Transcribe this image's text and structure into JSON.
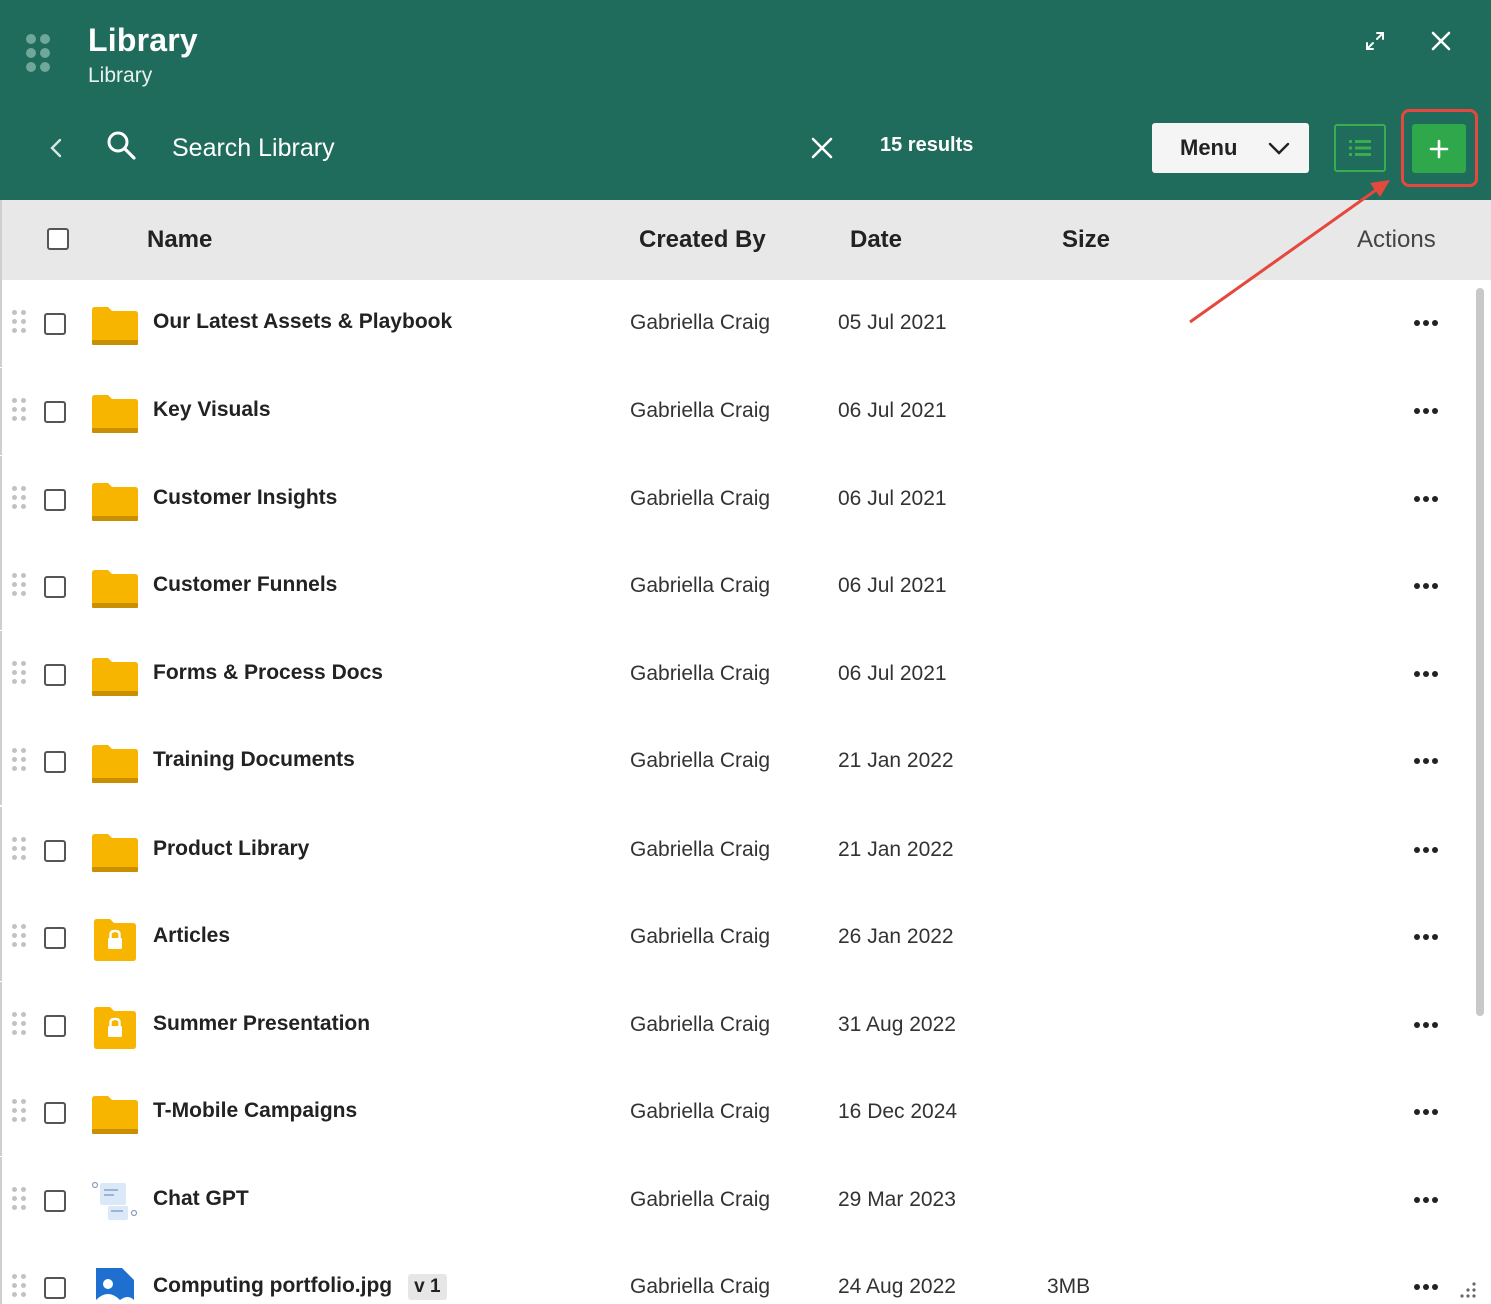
{
  "window": {
    "title": "Library",
    "subtitle": "Library"
  },
  "toolbar": {
    "search_placeholder": "Search Library",
    "results": "15 results",
    "menu_label": "Menu"
  },
  "columns": {
    "name": "Name",
    "created_by": "Created By",
    "date": "Date",
    "size": "Size",
    "actions": "Actions"
  },
  "colors": {
    "header_bg": "#1f6b5c",
    "add_button": "#2ea84a",
    "folder": "#f7b500",
    "highlight": "#e5483c"
  },
  "rows": [
    {
      "name": "Our Latest Assets & Playbook",
      "created_by": "Gabriella Craig",
      "date": "05 Jul 2021",
      "size": "",
      "icon": "folder-icon"
    },
    {
      "name": "Key Visuals",
      "created_by": "Gabriella Craig",
      "date": "06 Jul 2021",
      "size": "",
      "icon": "folder-icon"
    },
    {
      "name": "Customer Insights",
      "created_by": "Gabriella Craig",
      "date": "06 Jul 2021",
      "size": "",
      "icon": "folder-icon"
    },
    {
      "name": "Customer Funnels",
      "created_by": "Gabriella Craig",
      "date": "06 Jul 2021",
      "size": "",
      "icon": "folder-icon"
    },
    {
      "name": "Forms & Process Docs",
      "created_by": "Gabriella Craig",
      "date": "06 Jul 2021",
      "size": "",
      "icon": "folder-icon"
    },
    {
      "name": "Training Documents",
      "created_by": "Gabriella Craig",
      "date": "21 Jan 2022",
      "size": "",
      "icon": "folder-icon"
    },
    {
      "name": "Product Library",
      "created_by": "Gabriella Craig",
      "date": "21 Jan 2022",
      "size": "",
      "icon": "folder-icon"
    },
    {
      "name": "Articles",
      "created_by": "Gabriella Craig",
      "date": "26 Jan 2022",
      "size": "",
      "icon": "locked-folder-icon"
    },
    {
      "name": "Summer Presentation",
      "created_by": "Gabriella Craig",
      "date": "31 Aug 2022",
      "size": "",
      "icon": "locked-folder-icon"
    },
    {
      "name": "T-Mobile Campaigns",
      "created_by": "Gabriella Craig",
      "date": "16 Dec 2024",
      "size": "",
      "icon": "folder-icon"
    },
    {
      "name": "Chat GPT",
      "created_by": "Gabriella Craig",
      "date": "29 Mar 2023",
      "size": "",
      "icon": "document-icon"
    },
    {
      "name": "Computing portfolio.jpg",
      "version": "v 1",
      "created_by": "Gabriella Craig",
      "date": "24 Aug 2022",
      "size": "3MB",
      "icon": "image-file-icon"
    }
  ]
}
